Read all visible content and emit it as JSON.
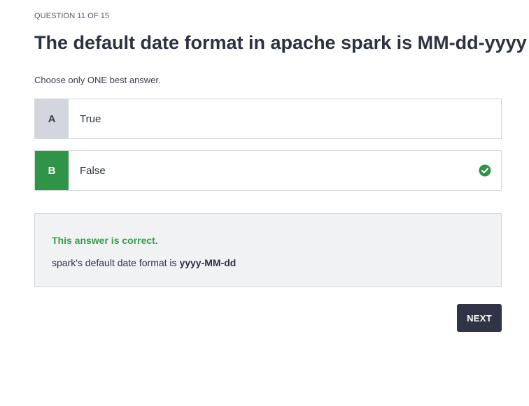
{
  "quiz": {
    "progress_label": "QUESTION 11 OF 15",
    "question": "The default date format in apache spark is MM-dd-yyyy",
    "instruction": "Choose only ONE best answer.",
    "options": [
      {
        "letter": "A",
        "text": "True",
        "selected": false,
        "correct": false
      },
      {
        "letter": "B",
        "text": "False",
        "selected": true,
        "correct": true
      }
    ],
    "feedback": {
      "title": "This answer is correct.",
      "text_prefix": "spark's default date format is ",
      "text_bold": "yyyy-MM-dd"
    },
    "next_label": "NEXT"
  },
  "colors": {
    "correct_green": "#2f9447",
    "letter_bg": "#d4d6dd",
    "button_dark": "#2f3447",
    "feedback_bg": "#f1f2f4"
  },
  "icons": {
    "correct_indicator": "check-circle-icon"
  }
}
